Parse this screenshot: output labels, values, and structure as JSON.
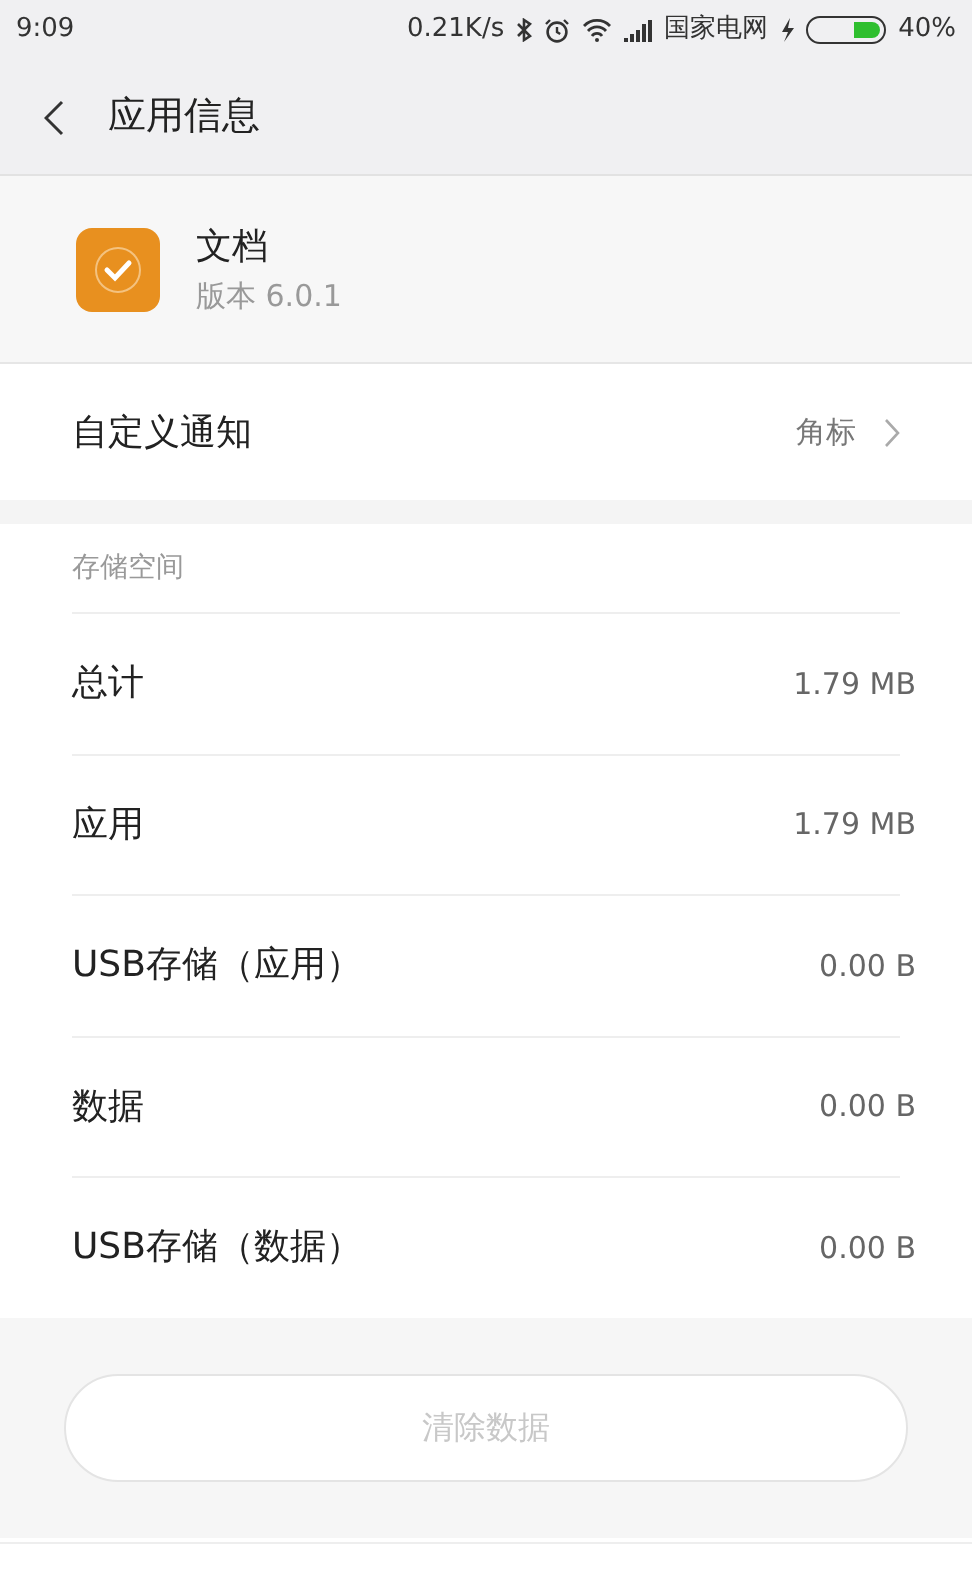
{
  "status_bar": {
    "time": "9:09",
    "speed": "0.21K/s",
    "carrier": "国家电网",
    "battery": "40%"
  },
  "header": {
    "title": "应用信息"
  },
  "app": {
    "name": "文档",
    "version": "版本 6.0.1"
  },
  "notification": {
    "label": "自定义通知",
    "value": "角标"
  },
  "storage": {
    "title": "存储空间",
    "rows": [
      {
        "label": "总计",
        "value": "1.79 MB"
      },
      {
        "label": "应用",
        "value": "1.79 MB"
      },
      {
        "label": "USB存储（应用）",
        "value": "0.00 B"
      },
      {
        "label": "数据",
        "value": "0.00 B"
      },
      {
        "label": "USB存储（数据）",
        "value": "0.00 B"
      }
    ]
  },
  "clear_button": {
    "label": "清除数据",
    "disabled": true
  }
}
